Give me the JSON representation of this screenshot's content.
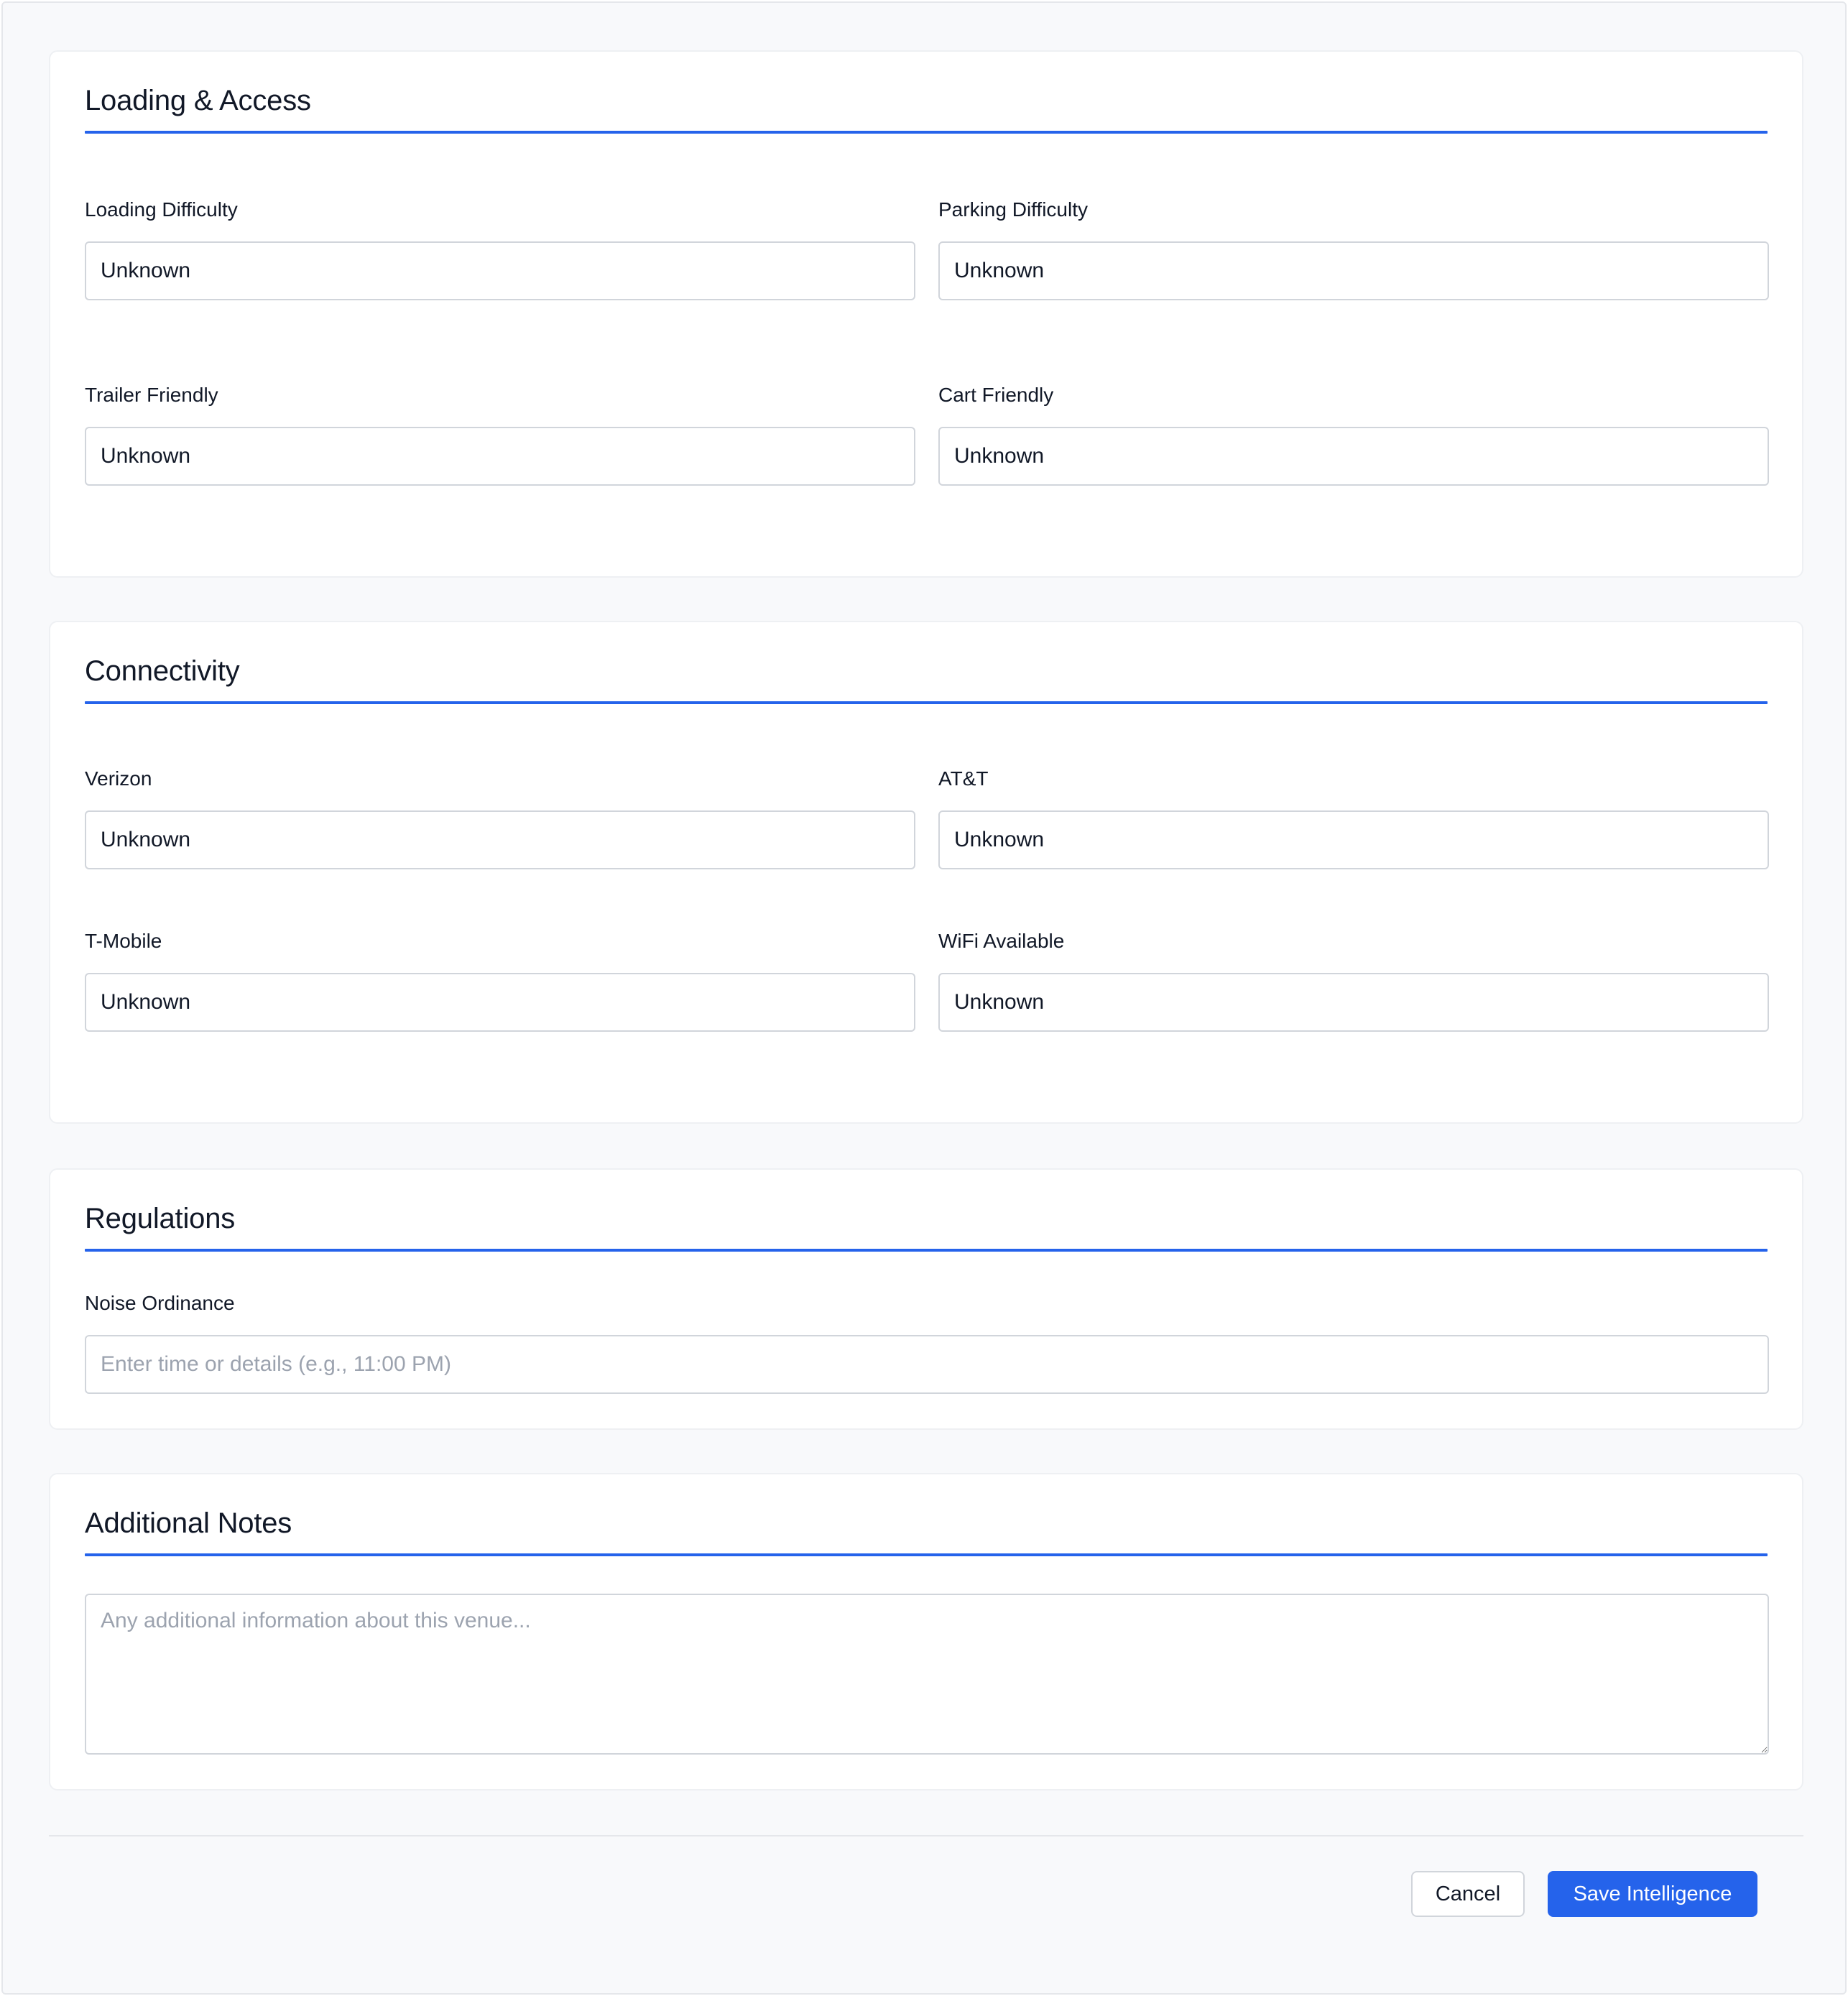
{
  "sections": {
    "loading": {
      "title": "Loading & Access",
      "fields": {
        "loading_difficulty": {
          "label": "Loading Difficulty",
          "value": "Unknown"
        },
        "parking_difficulty": {
          "label": "Parking Difficulty",
          "value": "Unknown"
        },
        "trailer_friendly": {
          "label": "Trailer Friendly",
          "value": "Unknown"
        },
        "cart_friendly": {
          "label": "Cart Friendly",
          "value": "Unknown"
        }
      }
    },
    "connectivity": {
      "title": "Connectivity",
      "fields": {
        "verizon": {
          "label": "Verizon",
          "value": "Unknown"
        },
        "att": {
          "label": "AT&T",
          "value": "Unknown"
        },
        "tmobile": {
          "label": "T-Mobile",
          "value": "Unknown"
        },
        "wifi": {
          "label": "WiFi Available",
          "value": "Unknown"
        }
      }
    },
    "regulations": {
      "title": "Regulations",
      "fields": {
        "noise": {
          "label": "Noise Ordinance",
          "value": "",
          "placeholder": "Enter time or details (e.g., 11:00 PM)"
        }
      }
    },
    "notes": {
      "title": "Additional Notes",
      "placeholder": "Any additional information about this venue...",
      "value": ""
    }
  },
  "footer": {
    "cancel_label": "Cancel",
    "save_label": "Save Intelligence"
  },
  "colors": {
    "accent": "#2563eb",
    "border": "#d1d5db",
    "background": "#f8f9fb"
  }
}
